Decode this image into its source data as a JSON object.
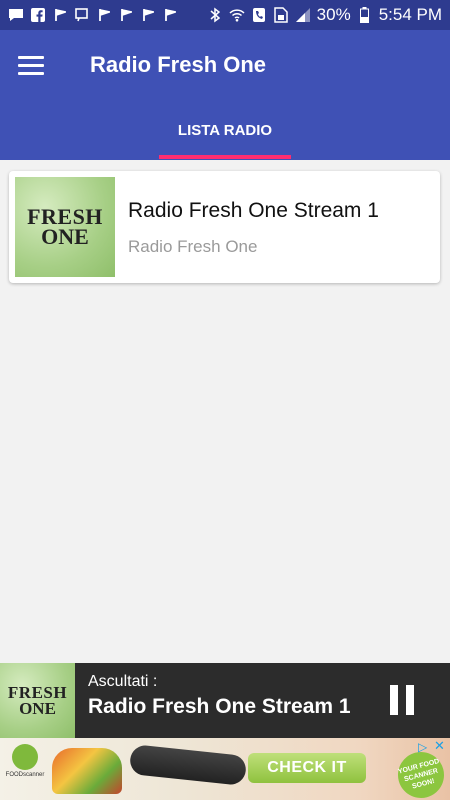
{
  "status_bar": {
    "battery": "30%",
    "time": "5:54 PM",
    "left_icons": [
      "chat-icon",
      "facebook-icon",
      "signal-flag-icon",
      "flag-outline-icon",
      "signal-flag-icon",
      "signal-flag-icon",
      "signal-flag-icon",
      "signal-flag-icon"
    ],
    "right_icons": [
      "bluetooth-icon",
      "wifi-icon",
      "phone-icon",
      "sim-icon",
      "signal-icon",
      "battery-icon"
    ]
  },
  "app_bar": {
    "title": "Radio Fresh One",
    "menu_icon": "hamburger-menu-icon",
    "tabs": [
      {
        "label": "LISTA RADIO",
        "selected": true
      }
    ],
    "colors": {
      "primary": "#3f51b5",
      "status": "#2e3b8f",
      "accent": "#ff2d6f"
    }
  },
  "stations": [
    {
      "title": "Radio Fresh One Stream 1",
      "subtitle": "Radio Fresh One",
      "logo_line1": "FRESH",
      "logo_line2": "ONE"
    }
  ],
  "player": {
    "label": "Ascultati :",
    "now_playing": "Radio Fresh One Stream 1",
    "logo_line1": "FRESH",
    "logo_line2": "ONE",
    "control_icon": "pause-icon"
  },
  "ad": {
    "brand": "FOODscanner",
    "cta": "CHECK IT",
    "badge": "YOUR FOOD SCANNER SOON!"
  }
}
